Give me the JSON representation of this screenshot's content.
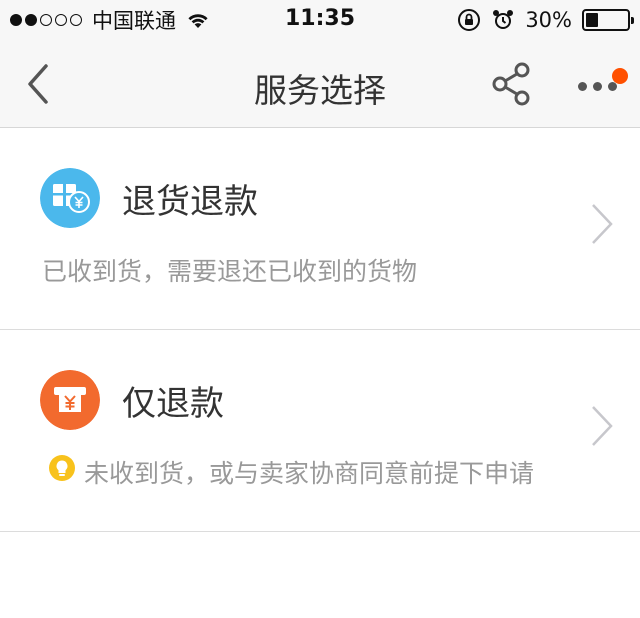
{
  "status_bar": {
    "carrier": "中国联通",
    "time": "11:35",
    "battery": "30%",
    "battery_level": 0.3,
    "signal_bars_filled": 2,
    "signal_bars_total": 5
  },
  "nav": {
    "title": "服务选择",
    "icons": [
      "chevron-left-icon",
      "share-icon",
      "more-icon"
    ],
    "notification_dot_color": "#ff5000"
  },
  "options": [
    {
      "title": "退货退款",
      "description": "已收到货，需要退还已收到的货物",
      "icon": "return-package-icon",
      "icon_color": "#4bb8ec"
    },
    {
      "title": "仅退款",
      "description": "未收到货，或与卖家协商同意前提下申请",
      "icon": "cash-refund-icon",
      "icon_color": "#f26a2e",
      "tip_icon": "lightbulb-icon",
      "tip_color": "#f8c21c"
    }
  ]
}
